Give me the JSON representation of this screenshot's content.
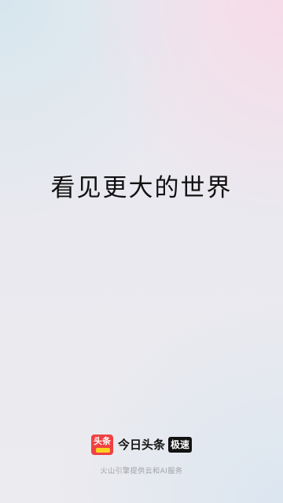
{
  "splash": {
    "slogan": "看见更大的世界"
  },
  "brand": {
    "logo_text": "头条",
    "logo_icon": "toutiao-logo-icon",
    "logo_color": "#f04142",
    "logo_accent": "#ffd21f",
    "app_name": "今日头条",
    "edition_badge": "极速"
  },
  "footer": {
    "powered_by": "火山引擎提供云和AI服务"
  }
}
